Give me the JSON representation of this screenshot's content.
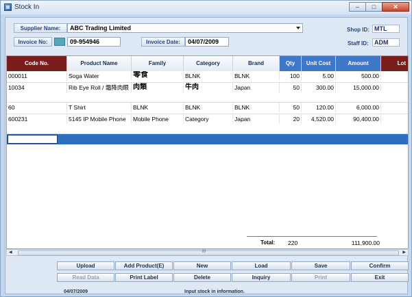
{
  "window": {
    "title": "Stock In"
  },
  "header": {
    "supplier_label": "Supplier Name:",
    "supplier_value": "ABC Trading Limited",
    "shop_id_label": "Shop ID:",
    "shop_id_value": "MTL",
    "invoice_no_label": "Invoice No:",
    "invoice_no_value": "09-954946",
    "invoice_date_label": "Invoice Date:",
    "invoice_date_value": "04/07/2009",
    "staff_id_label": "Staff ID:",
    "staff_id_value": "ADM"
  },
  "table": {
    "columns": [
      "Code No.",
      "Product Name",
      "Family",
      "Category",
      "Brand",
      "Qty",
      "Unit Cost",
      "Amount",
      "Lot"
    ],
    "rows": [
      {
        "code": "000011",
        "product": "Soga Water",
        "family": "零食",
        "category": "BLNK",
        "brand": "BLNK",
        "qty": "100",
        "unit_cost": "5.00",
        "amount": "500.00"
      },
      {
        "code": "10034",
        "product": "Rib Eye Roll / 霜降肉眼",
        "family": "肉類",
        "category": "牛肉",
        "brand": "Japan",
        "qty": "50",
        "unit_cost": "300.00",
        "amount": "15,000.00"
      },
      {
        "code": "60",
        "product": "T Shirt",
        "family": "BLNK",
        "category": "BLNK",
        "brand": "BLNK",
        "qty": "50",
        "unit_cost": "120.00",
        "amount": "6,000.00"
      },
      {
        "code": "600231",
        "product": "5145 IP Mobile Phone",
        "family": "Mobile Phone",
        "category": "Category",
        "brand": "Japan",
        "qty": "20",
        "unit_cost": "4,520.00",
        "amount": "90,400.00"
      }
    ],
    "total_label": "Total:",
    "total_qty": "220",
    "total_amount": "111,900.00",
    "scroll_mark": "III"
  },
  "buttons": {
    "upload": "Upload",
    "add_product": "Add Product(E)",
    "new": "New",
    "load": "Load",
    "save": "Save",
    "confirm": "Confirm",
    "read_data": "Read Data",
    "print_label": "Print Label",
    "delete": "Delete",
    "inquiry": "Inquiry",
    "print": "Print",
    "exit": "Exit"
  },
  "status": {
    "date": "04/07/2009",
    "message": "Input stock in information."
  }
}
